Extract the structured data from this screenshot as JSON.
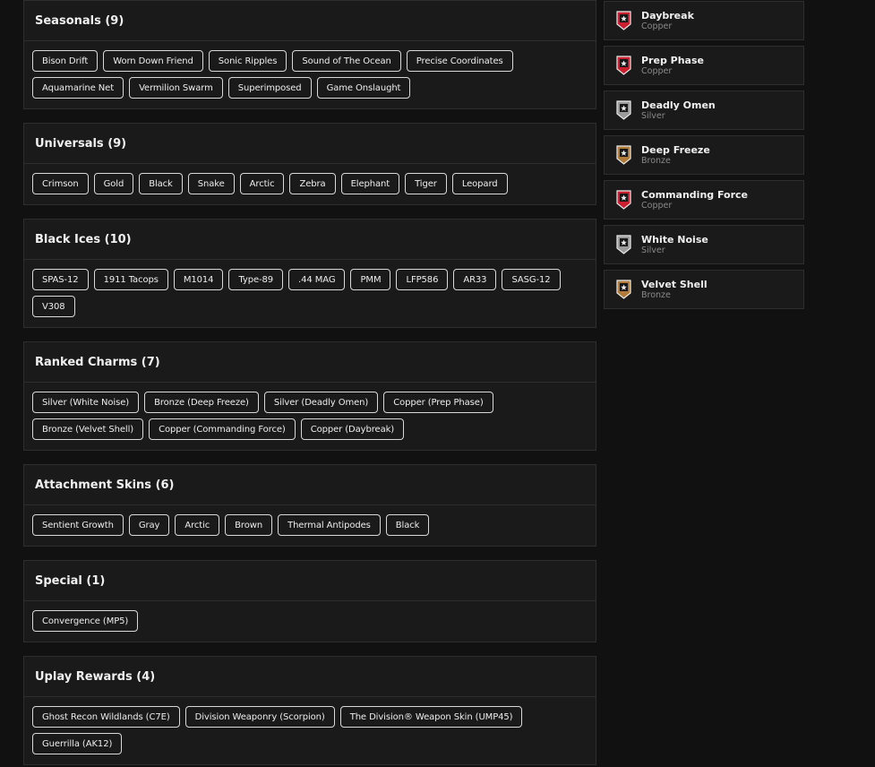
{
  "sections": [
    {
      "title": "Seasonals (9)",
      "items": [
        "Bison Drift",
        "Worn Down Friend",
        "Sonic Ripples",
        "Sound of The Ocean",
        "Precise Coordinates",
        "Aquamarine Net",
        "Vermilion Swarm",
        "Superimposed",
        "Game Onslaught"
      ]
    },
    {
      "title": "Universals (9)",
      "items": [
        "Crimson",
        "Gold",
        "Black",
        "Snake",
        "Arctic",
        "Zebra",
        "Elephant",
        "Tiger",
        "Leopard"
      ]
    },
    {
      "title": "Black Ices (10)",
      "items": [
        "SPAS-12",
        "1911 Tacops",
        "M1014",
        "Type-89",
        ".44 MAG",
        "PMM",
        "LFP586",
        "AR33",
        "SASG-12",
        "V308"
      ]
    },
    {
      "title": "Ranked Charms (7)",
      "items": [
        "Silver (White Noise)",
        "Bronze (Deep Freeze)",
        "Silver (Deadly Omen)",
        "Copper (Prep Phase)",
        "Bronze (Velvet Shell)",
        "Copper (Commanding Force)",
        "Copper (Daybreak)"
      ]
    },
    {
      "title": "Attachment Skins (6)",
      "items": [
        "Sentient Growth",
        "Gray",
        "Arctic",
        "Brown",
        "Thermal Antipodes",
        "Black"
      ]
    },
    {
      "title": "Special (1)",
      "items": [
        "Convergence (MP5)"
      ]
    },
    {
      "title": "Uplay Rewards (4)",
      "items": [
        "Ghost Recon Wildlands (C7E)",
        "Division Weaponry (Scorpion)",
        "The Division® Weapon Skin (UMP45)",
        "Guerrilla (AK12)"
      ]
    }
  ],
  "ranks": [
    {
      "name": "Daybreak",
      "tier": "Copper",
      "icon": "copper-rank-icon",
      "color": "#c8202e"
    },
    {
      "name": "Prep Phase",
      "tier": "Copper",
      "icon": "copper-rank-icon",
      "color": "#c8202e"
    },
    {
      "name": "Deadly Omen",
      "tier": "Silver",
      "icon": "silver-rank-icon",
      "color": "#9a9a9a"
    },
    {
      "name": "Deep Freeze",
      "tier": "Bronze",
      "icon": "bronze-rank-icon",
      "color": "#b07a3a"
    },
    {
      "name": "Commanding Force",
      "tier": "Copper",
      "icon": "copper-rank-icon",
      "color": "#c8202e"
    },
    {
      "name": "White Noise",
      "tier": "Silver",
      "icon": "silver-rank-icon",
      "color": "#9a9a9a"
    },
    {
      "name": "Velvet Shell",
      "tier": "Bronze",
      "icon": "bronze-rank-icon",
      "color": "#b07a3a"
    }
  ]
}
